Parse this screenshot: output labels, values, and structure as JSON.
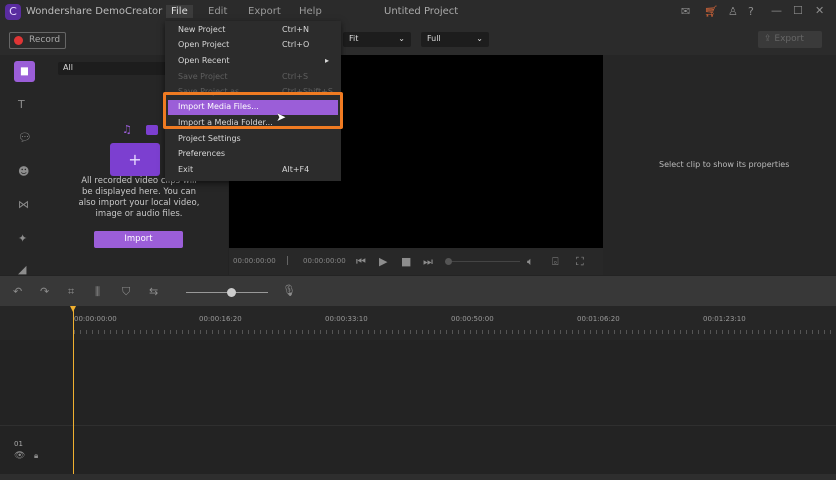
{
  "app": {
    "title": "Wondershare DemoCreator",
    "project": "Untited Project"
  },
  "menubar": [
    "File",
    "Edit",
    "Export",
    "Help"
  ],
  "toolbar": {
    "record": "Record",
    "fit": "Fit",
    "quality": "Full",
    "export": "Export"
  },
  "media": {
    "filter": "All",
    "empty_text": "All recorded video clips will be displayed here. You can also import your local video, image or audio files.",
    "import": "Import"
  },
  "props": {
    "placeholder": "Select clip to show its properties"
  },
  "player": {
    "current": "00:00:00:00",
    "total": "00:00:00:00"
  },
  "ruler": [
    "00:00:00:00",
    "00:00:16:20",
    "00:00:33:10",
    "00:00:50:00",
    "00:01:06:20",
    "00:01:23:10"
  ],
  "track": {
    "number": "01"
  },
  "file_menu": [
    {
      "label": "New Project",
      "shortcut": "Ctrl+N"
    },
    {
      "label": "Open Project",
      "shortcut": "Ctrl+O"
    },
    {
      "label": "Open Recent",
      "shortcut": ""
    },
    {
      "label": "Save Project",
      "shortcut": "Ctrl+S",
      "disabled": true
    },
    {
      "label": "Save Project as...",
      "shortcut": "Ctrl+Shift+S",
      "disabled": true
    },
    {
      "label": "Import Media Files...",
      "shortcut": "",
      "highlighted": true
    },
    {
      "label": "Import a Media Folder...",
      "shortcut": ""
    },
    {
      "label": "Project Settings",
      "shortcut": ""
    },
    {
      "label": "Preferences",
      "shortcut": ""
    },
    {
      "label": "Exit",
      "shortcut": "Alt+F4"
    }
  ],
  "colors": {
    "accent": "#9b5ed8",
    "highlight_box": "#f07b22",
    "playhead": "#f0b030",
    "record": "#e03535"
  }
}
